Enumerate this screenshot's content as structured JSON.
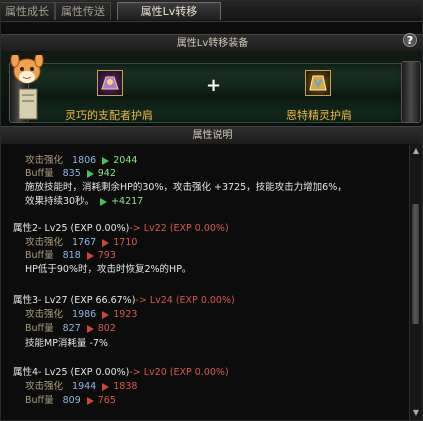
{
  "tabs": [
    {
      "label": "属性成长"
    },
    {
      "label": "属性传送"
    },
    {
      "label": "属性Lv转移"
    }
  ],
  "equip_header": "属性Lv转移装备",
  "help_label": "?",
  "items": {
    "left_name": "灵巧的支配者护肩",
    "right_name": "恩特精灵护肩",
    "plus": "+"
  },
  "desc_header": "属性说明",
  "lines": {
    "l1_label": "攻击强化",
    "l1_from": "1806",
    "l1_to": "2044",
    "l2_label": "Buff量",
    "l2_from": "835",
    "l2_to": "942",
    "l3_text": "施放技能时，消耗剩余HP的30%，攻击强化 +3725，技能攻击力增加6%，",
    "l4_text": "效果持续30秒。",
    "l4_val": "+4217",
    "a2_head": "属性2- Lv25 (EXP 0.00%)",
    "a2_arrow": "-> Lv22 (EXP 0.00%)",
    "a2_l1_label": "攻击强化",
    "a2_l1_from": "1767",
    "a2_l1_to": "1710",
    "a2_l2_label": "Buff量",
    "a2_l2_from": "818",
    "a2_l2_to": "793",
    "a2_effect": "HP低于90%时，攻击时恢复2%的HP。",
    "a3_head": "属性3- Lv27 (EXP 66.67%)",
    "a3_arrow": "-> Lv24 (EXP 0.00%)",
    "a3_l1_label": "攻击强化",
    "a3_l1_from": "1986",
    "a3_l1_to": "1923",
    "a3_l2_label": "Buff量",
    "a3_l2_from": "827",
    "a3_l2_to": "802",
    "a3_effect": "技能MP消耗量 -7%",
    "a4_head": "属性4- Lv25 (EXP 0.00%)",
    "a4_arrow": "-> Lv20 (EXP 0.00%)",
    "a4_l1_label": "攻击强化",
    "a4_l1_from": "1944",
    "a4_l1_to": "1838",
    "a4_l2_label": "Buff量",
    "a4_l2_from": "809",
    "a4_l2_to": "765"
  },
  "colors": {
    "gold": "#f0b640",
    "up": "#47c25a",
    "down": "#d04538"
  }
}
